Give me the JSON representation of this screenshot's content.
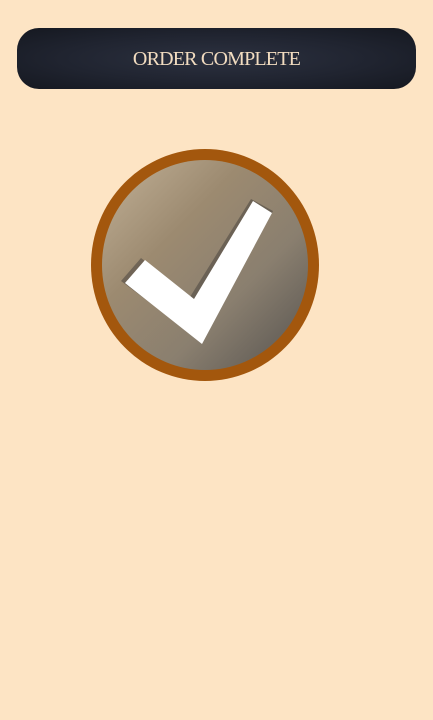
{
  "header": {
    "title": "ORDER COMPLETE"
  },
  "status_icon": {
    "icon": "checkmark-icon",
    "state": "success"
  },
  "colors": {
    "page_background": "#fde4c4",
    "header_background": "#202430",
    "header_text": "#f2dcc0",
    "ring": "#a3570d",
    "disc_light": "#b8a489",
    "disc_dark": "#5e5a55",
    "check": "#ffffff"
  }
}
